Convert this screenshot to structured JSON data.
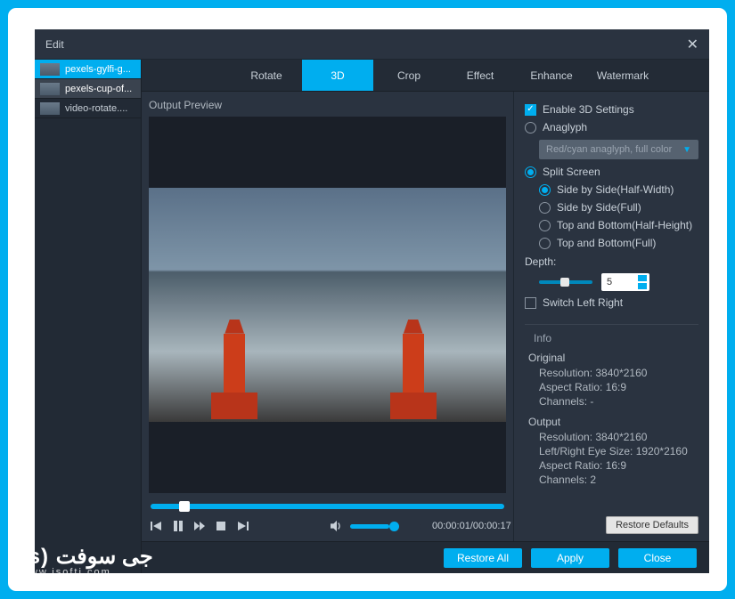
{
  "window": {
    "title": "Edit"
  },
  "sidebar": {
    "items": [
      {
        "label": "pexels-gylfi-g..."
      },
      {
        "label": "pexels-cup-of..."
      },
      {
        "label": "video-rotate...."
      }
    ]
  },
  "tabs": [
    {
      "label": "Rotate"
    },
    {
      "label": "3D"
    },
    {
      "label": "Crop"
    },
    {
      "label": "Effect"
    },
    {
      "label": "Enhance"
    },
    {
      "label": "Watermark"
    }
  ],
  "preview": {
    "label": "Output Preview"
  },
  "player": {
    "time_current": "00:00:01",
    "time_total": "00:00:17"
  },
  "settings": {
    "enable_label": "Enable 3D Settings",
    "anaglyph_label": "Anaglyph",
    "anaglyph_dropdown": "Red/cyan anaglyph, full color",
    "split_label": "Split Screen",
    "split_options": [
      "Side by Side(Half-Width)",
      "Side by Side(Full)",
      "Top and Bottom(Half-Height)",
      "Top and Bottom(Full)"
    ],
    "depth_label": "Depth:",
    "depth_value": "5",
    "switch_label": "Switch Left Right"
  },
  "info": {
    "title": "Info",
    "original": {
      "head": "Original",
      "resolution_label": "Resolution: 3840*2160",
      "aspect_label": "Aspect Ratio: 16:9",
      "channels_label": "Channels: -"
    },
    "output": {
      "head": "Output",
      "resolution_label": "Resolution: 3840*2160",
      "eye_label": "Left/Right Eye Size: 1920*2160",
      "aspect_label": "Aspect Ratio: 16:9",
      "channels_label": "Channels: 2"
    }
  },
  "buttons": {
    "restore_defaults": "Restore Defaults",
    "restore_all": "Restore All",
    "apply": "Apply",
    "close": "Close"
  },
  "watermark": {
    "brand": "جى سوفت",
    "url": "www.jsoftj.com"
  }
}
